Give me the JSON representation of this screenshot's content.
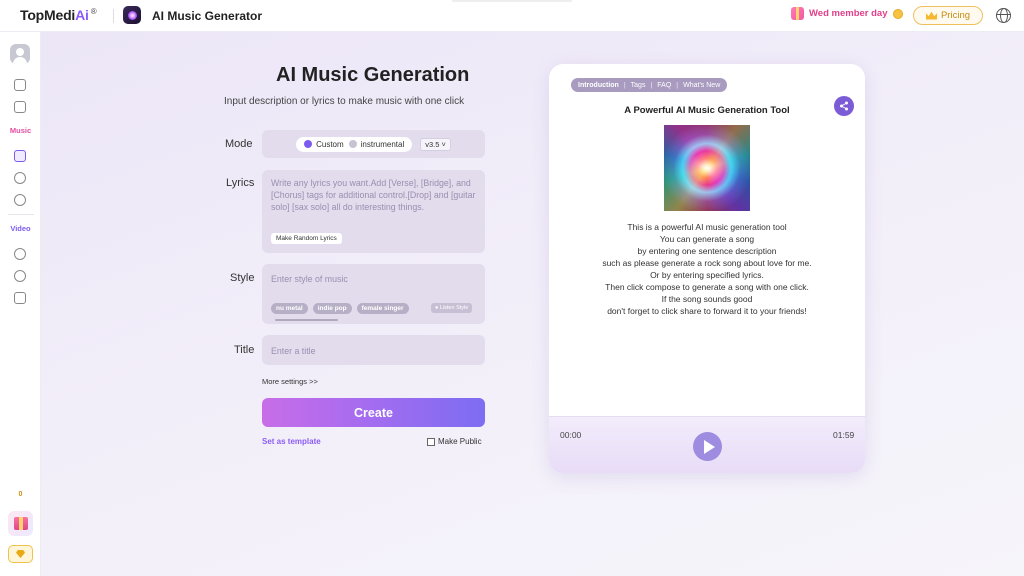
{
  "topbar": {
    "brand_main": "TopMedi",
    "brand_ai": "Ai",
    "brand_reg": "®",
    "app_title": "AI Music Generator",
    "member_day": "Wed member day",
    "pricing_label": "Pricing"
  },
  "sidebar": {
    "music_label": "Music",
    "video_label": "Video",
    "count": "0"
  },
  "main": {
    "heading": "AI Music Generation",
    "subheading": "Input description or lyrics to make music with one click",
    "mode": {
      "label": "Mode",
      "custom": "Custom",
      "instrumental": "instrumental",
      "version": "v3.5"
    },
    "lyrics": {
      "label": "Lyrics",
      "placeholder": "Write any lyrics you want.Add [Verse], [Bridge], and [Chorus] tags for additional control.[Drop] and [guitar solo] [sax solo] all do interesting things.",
      "random_button": "Make Random Lyrics"
    },
    "style": {
      "label": "Style",
      "placeholder": "Enter style of music",
      "tags": [
        "nu metal",
        "indie pop",
        "female singer"
      ],
      "listen_style": "Listen Style"
    },
    "title": {
      "label": "Title",
      "placeholder": "Enter a title"
    },
    "more_settings": "More settings >>",
    "create_button": "Create",
    "set_template": "Set as template",
    "make_public": "Make Public"
  },
  "card": {
    "tabs": [
      "Introduction",
      "Tags",
      "FAQ",
      "What's New"
    ],
    "title": "A Powerful AI Music Generation Tool",
    "description": [
      "This is a powerful AI music generation tool",
      "You can generate a song",
      "by entering one sentence description",
      "such as please generate a rock song about love for me.",
      "Or by entering specified lyrics.",
      "Then click compose to generate a song with one click.",
      "If the song sounds good",
      "don't forget to click share to forward it to your friends!"
    ],
    "player": {
      "current_time": "00:00",
      "duration": "01:59"
    }
  },
  "colors": {
    "accent": "#7c5cf0",
    "music": "#e24da0",
    "pricing": "#c88a10"
  }
}
